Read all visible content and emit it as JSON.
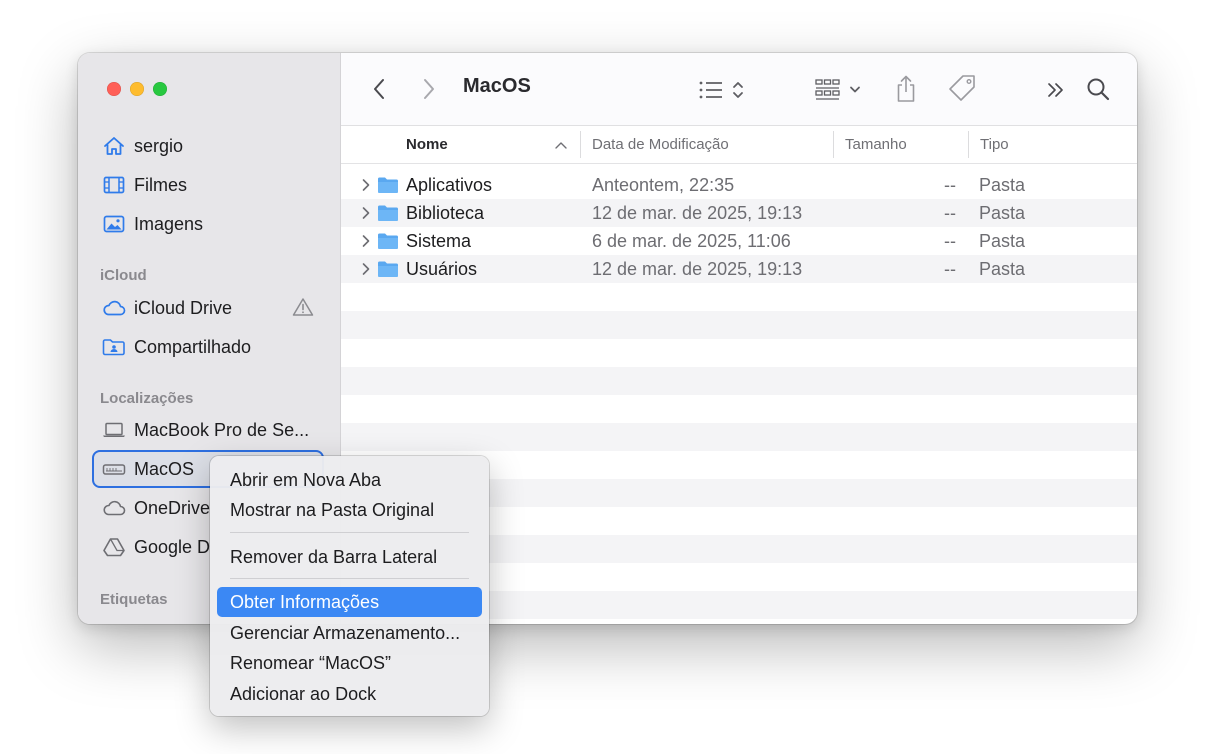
{
  "window": {
    "title": "MacOS"
  },
  "sidebar": {
    "favorites": [
      {
        "label": "sergio",
        "icon": "house-icon"
      },
      {
        "label": "Filmes",
        "icon": "film-icon"
      },
      {
        "label": "Imagens",
        "icon": "photo-icon"
      }
    ],
    "icloud_header": "iCloud",
    "icloud": [
      {
        "label": "iCloud Drive",
        "icon": "cloud-icon",
        "warning": true
      },
      {
        "label": "Compartilhado",
        "icon": "shared-folder-icon"
      }
    ],
    "locations_header": "Localizações",
    "locations": [
      {
        "label": "MacBook Pro de Se...",
        "icon": "laptop-icon"
      },
      {
        "label": "MacOS",
        "icon": "drive-icon",
        "selected": true
      },
      {
        "label": "OneDrive",
        "icon": "cloud-icon"
      },
      {
        "label": "Google D",
        "icon": "google-drive-icon"
      }
    ],
    "tags_header": "Etiquetas"
  },
  "columns": {
    "name": "Nome",
    "date": "Data de Modificação",
    "size": "Tamanho",
    "kind": "Tipo"
  },
  "files": [
    {
      "name": "Aplicativos",
      "date": "Anteontem, 22:35",
      "size": "--",
      "kind": "Pasta"
    },
    {
      "name": "Biblioteca",
      "date": "12 de mar. de 2025, 19:13",
      "size": "--",
      "kind": "Pasta"
    },
    {
      "name": "Sistema",
      "date": "6 de mar. de 2025, 11:06",
      "size": "--",
      "kind": "Pasta"
    },
    {
      "name": "Usuários",
      "date": "12 de mar. de 2025, 19:13",
      "size": "--",
      "kind": "Pasta"
    }
  ],
  "context_menu": {
    "items": [
      "Abrir em Nova Aba",
      "Mostrar na Pasta Original",
      "Remover da Barra Lateral",
      "Obter Informações",
      "Gerenciar Armazenamento...",
      "Renomear “MacOS”",
      "Adicionar ao Dock"
    ],
    "highlighted_index": 3
  },
  "colors": {
    "accent": "#2d6fe0",
    "menu_highlight": "#3b88f4",
    "folder": "#5aa8f0"
  }
}
